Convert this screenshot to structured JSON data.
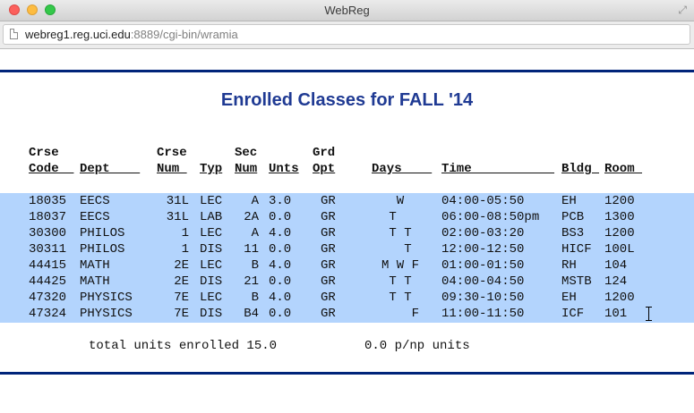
{
  "window": {
    "title": "WebReg"
  },
  "address_bar": {
    "host": "webreg1.reg.uci.edu",
    "rest": ":8889/cgi-bin/wramia"
  },
  "page": {
    "heading": "Enrolled Classes for FALL '14"
  },
  "columns": [
    {
      "key": "code",
      "top": "Crse",
      "bottom": "Code"
    },
    {
      "key": "dept",
      "top": "",
      "bottom": "Dept"
    },
    {
      "key": "num",
      "top": "Crse",
      "bottom": "Num"
    },
    {
      "key": "typ",
      "top": "",
      "bottom": "Typ"
    },
    {
      "key": "sec",
      "top": "Sec",
      "bottom": "Num"
    },
    {
      "key": "units",
      "top": "",
      "bottom": "Unts"
    },
    {
      "key": "opt",
      "top": "Grd",
      "bottom": "Opt"
    },
    {
      "key": "days",
      "top": "",
      "bottom": "Days"
    },
    {
      "key": "time",
      "top": "",
      "bottom": "Time"
    },
    {
      "key": "bldg",
      "top": "",
      "bottom": "Bldg"
    },
    {
      "key": "room",
      "top": "",
      "bottom": "Room"
    }
  ],
  "rows": [
    {
      "code": "18035",
      "dept": "EECS",
      "num": "31L",
      "typ": "LEC",
      "sec": "A",
      "units": "3.0",
      "opt": "GR",
      "days": "  W",
      "time": "04:00-05:50",
      "bldg": "EH",
      "room": "1200"
    },
    {
      "code": "18037",
      "dept": "EECS",
      "num": "31L",
      "typ": "LAB",
      "sec": "2A",
      "units": "0.0",
      "opt": "GR",
      "days": " T",
      "time": "06:00-08:50pm",
      "bldg": "PCB",
      "room": "1300"
    },
    {
      "code": "30300",
      "dept": "PHILOS",
      "num": "1",
      "typ": "LEC",
      "sec": "A",
      "units": "4.0",
      "opt": "GR",
      "days": " T T",
      "time": "02:00-03:20",
      "bldg": "BS3",
      "room": "1200"
    },
    {
      "code": "30311",
      "dept": "PHILOS",
      "num": "1",
      "typ": "DIS",
      "sec": "11",
      "units": "0.0",
      "opt": "GR",
      "days": "   T",
      "time": "12:00-12:50",
      "bldg": "HICF",
      "room": "100L"
    },
    {
      "code": "44415",
      "dept": "MATH",
      "num": "2E",
      "typ": "LEC",
      "sec": "B",
      "units": "4.0",
      "opt": "GR",
      "days": "M W F",
      "time": "01:00-01:50",
      "bldg": "RH",
      "room": "104"
    },
    {
      "code": "44425",
      "dept": "MATH",
      "num": "2E",
      "typ": "DIS",
      "sec": "21",
      "units": "0.0",
      "opt": "GR",
      "days": " T T",
      "time": "04:00-04:50",
      "bldg": "MSTB",
      "room": "124"
    },
    {
      "code": "47320",
      "dept": "PHYSICS",
      "num": "7E",
      "typ": "LEC",
      "sec": "B",
      "units": "4.0",
      "opt": "GR",
      "days": " T T",
      "time": "09:30-10:50",
      "bldg": "EH",
      "room": "1200"
    },
    {
      "code": "47324",
      "dept": "PHYSICS",
      "num": "7E",
      "typ": "DIS",
      "sec": "B4",
      "units": "0.0",
      "opt": "GR",
      "days": "    F",
      "time": "11:00-11:50",
      "bldg": "ICF",
      "room": "101"
    }
  ],
  "totals": {
    "enrolled": "total units enrolled 15.0",
    "pnp": "0.0 p/np units"
  },
  "colors": {
    "heading": "#1f3a93",
    "rule": "#00247a",
    "selection": "#b3d4fd"
  }
}
